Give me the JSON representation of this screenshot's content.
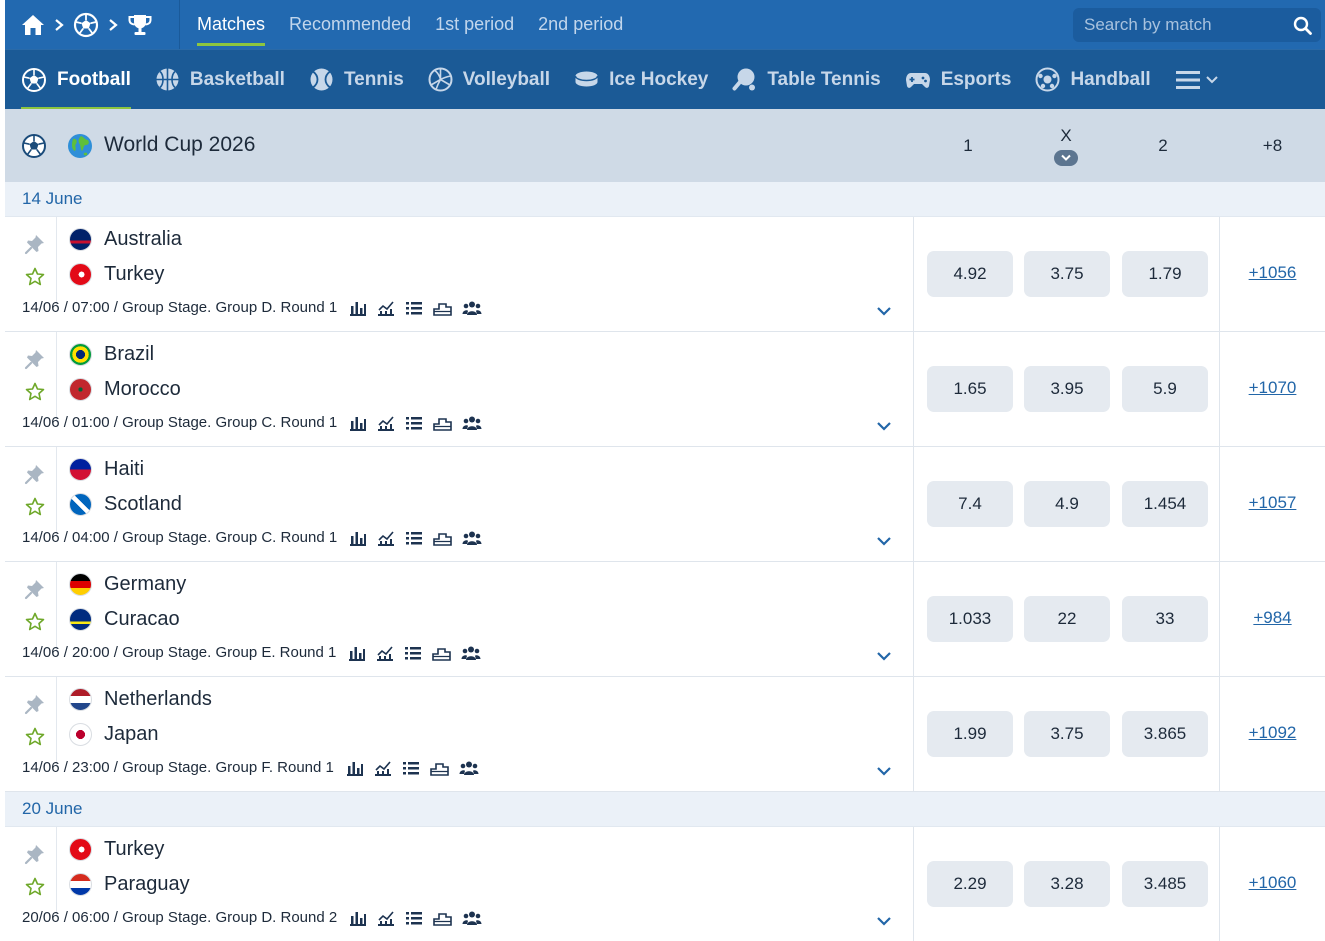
{
  "colors": {
    "nav": "#2269b0",
    "sports_bar": "#1b5a96",
    "accent": "#8dc63f",
    "league_bg": "#cfdae6",
    "link": "#2266a8"
  },
  "breadcrumb": [
    "home-icon",
    "soccer-ball-icon",
    "trophy-icon"
  ],
  "top_tabs": [
    {
      "label": "Matches",
      "active": true
    },
    {
      "label": "Recommended",
      "active": false
    },
    {
      "label": "1st period",
      "active": false
    },
    {
      "label": "2nd period",
      "active": false
    }
  ],
  "search": {
    "placeholder": "Search by match"
  },
  "sports": [
    {
      "label": "Football",
      "icon": "football-icon",
      "active": true
    },
    {
      "label": "Basketball",
      "icon": "basketball-icon",
      "active": false
    },
    {
      "label": "Tennis",
      "icon": "tennis-icon",
      "active": false
    },
    {
      "label": "Volleyball",
      "icon": "volleyball-icon",
      "active": false
    },
    {
      "label": "Ice Hockey",
      "icon": "ice-hockey-icon",
      "active": false
    },
    {
      "label": "Table Tennis",
      "icon": "table-tennis-icon",
      "active": false
    },
    {
      "label": "Esports",
      "icon": "gamepad-icon",
      "active": false
    },
    {
      "label": "Handball",
      "icon": "handball-icon",
      "active": false
    }
  ],
  "league": {
    "title": "World Cup 2026",
    "col1": "1",
    "colx": "X",
    "col2": "2",
    "more": "+8"
  },
  "dates": [
    "14 June",
    "20 June"
  ],
  "matches": [
    {
      "team1": "Australia",
      "team2": "Turkey",
      "meta": "14/06 / 07:00 / Group Stage. Group D. Round 1",
      "odds": [
        "4.92",
        "3.75",
        "1.79"
      ],
      "more": "+1056"
    },
    {
      "team1": "Brazil",
      "team2": "Morocco",
      "meta": "14/06 / 01:00 / Group Stage. Group C. Round 1",
      "odds": [
        "1.65",
        "3.95",
        "5.9"
      ],
      "more": "+1070"
    },
    {
      "team1": "Haiti",
      "team2": "Scotland",
      "meta": "14/06 / 04:00 / Group Stage. Group C. Round 1",
      "odds": [
        "7.4",
        "4.9",
        "1.454"
      ],
      "more": "+1057"
    },
    {
      "team1": "Germany",
      "team2": "Curacao",
      "meta": "14/06 / 20:00 / Group Stage. Group E. Round 1",
      "odds": [
        "1.033",
        "22",
        "33"
      ],
      "more": "+984"
    },
    {
      "team1": "Netherlands",
      "team2": "Japan",
      "meta": "14/06 / 23:00 / Group Stage. Group F. Round 1",
      "odds": [
        "1.99",
        "3.75",
        "3.865"
      ],
      "more": "+1092"
    },
    {
      "team1": "Turkey",
      "team2": "Paraguay",
      "meta": "20/06 / 06:00 / Group Stage. Group D. Round 2",
      "odds": [
        "2.29",
        "3.28",
        "3.485"
      ],
      "more": "+1060"
    }
  ]
}
